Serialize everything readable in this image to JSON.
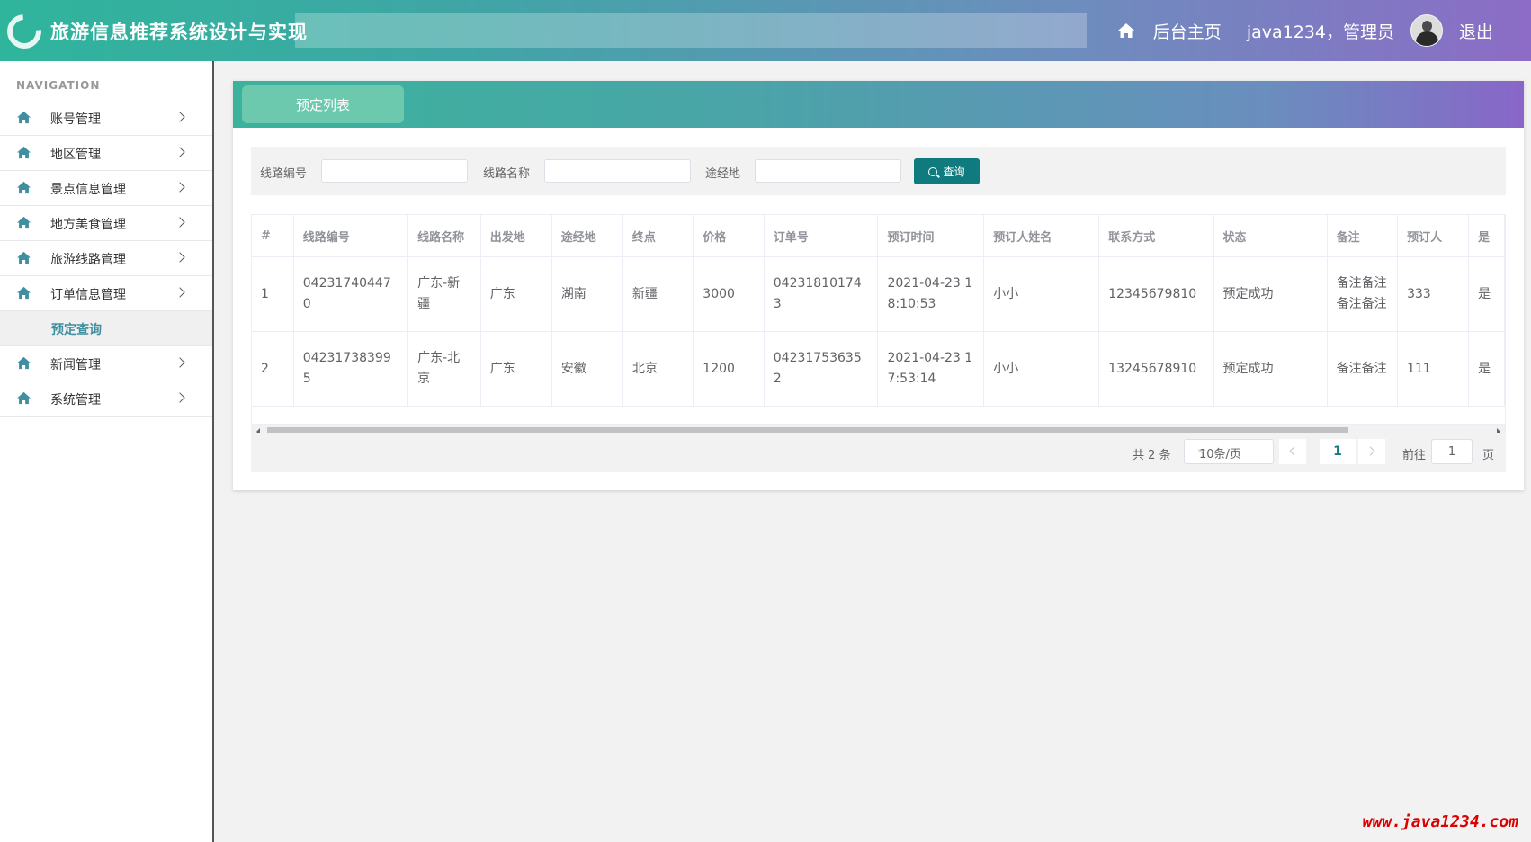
{
  "header": {
    "title": "旅游信息推荐系统设计与实现",
    "home_link": "后台主页",
    "user": "java1234，管理员",
    "logout": "退出",
    "home_icon": "home-icon",
    "avatar_icon": "avatar"
  },
  "sidebar": {
    "heading": "NAVIGATION",
    "items": [
      {
        "label": "账号管理",
        "icon": "home-icon"
      },
      {
        "label": "地区管理",
        "icon": "home-icon"
      },
      {
        "label": "景点信息管理",
        "icon": "home-icon"
      },
      {
        "label": "地方美食管理",
        "icon": "home-icon"
      },
      {
        "label": "旅游线路管理",
        "icon": "home-icon"
      },
      {
        "label": "订单信息管理",
        "icon": "home-icon"
      }
    ],
    "active_sub": "预定查询",
    "items_after": [
      {
        "label": "新闻管理",
        "icon": "home-icon"
      },
      {
        "label": "系统管理",
        "icon": "home-icon"
      }
    ]
  },
  "panel": {
    "tab_label": "预定列表"
  },
  "search": {
    "route_no_label": "线路编号",
    "route_no_value": "",
    "route_name_label": "线路名称",
    "route_name_value": "",
    "via_label": "途经地",
    "via_value": "",
    "button": "查询"
  },
  "table": {
    "headers": [
      "#",
      "线路编号",
      "线路名称",
      "出发地",
      "途经地",
      "终点",
      "价格",
      "订单号",
      "预订时间",
      "预订人姓名",
      "联系方式",
      "状态",
      "备注",
      "预订人",
      "是"
    ],
    "rows": [
      [
        "1",
        "042317404470",
        "广东-新疆",
        "广东",
        "湖南",
        "新疆",
        "3000",
        "042318101743",
        "2021-04-23 18:10:53",
        "小小",
        "12345679810",
        "预定成功",
        "备注备注备注备注",
        "333",
        "是"
      ],
      [
        "2",
        "042317383995",
        "广东-北京",
        "广东",
        "安徽",
        "北京",
        "1200",
        "042317536352",
        "2021-04-23 17:53:14",
        "小小",
        "13245678910",
        "预定成功",
        "备注备注",
        "111",
        "是"
      ]
    ]
  },
  "pagination": {
    "total": "共 2 条",
    "page_size": "10条/页",
    "current_page": "1",
    "goto_label": "前往",
    "goto_value": "1",
    "page_suffix": "页"
  },
  "watermark": "www.java1234.com",
  "colors": {
    "accent": "#107b7e",
    "header_start": "#2fb59c",
    "header_end": "#8c6cc6"
  }
}
